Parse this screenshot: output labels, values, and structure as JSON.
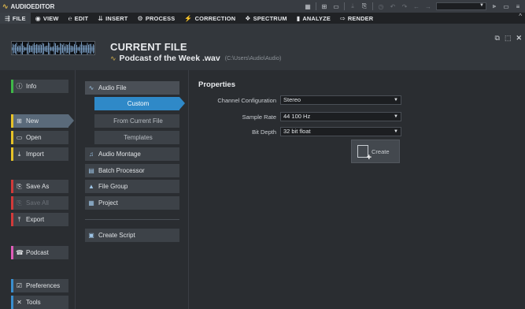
{
  "app": {
    "title": "AUDIOEDITOR"
  },
  "menu": {
    "items": [
      {
        "icon": "⇶",
        "label": "FILE"
      },
      {
        "icon": "◉",
        "label": "VIEW"
      },
      {
        "icon": "℮",
        "label": "EDIT"
      },
      {
        "icon": "⇊",
        "label": "INSERT"
      },
      {
        "icon": "⚙",
        "label": "PROCESS"
      },
      {
        "icon": "⚡",
        "label": "CORRECTION"
      },
      {
        "icon": "❖",
        "label": "SPECTRUM"
      },
      {
        "icon": "▮",
        "label": "ANALYZE"
      },
      {
        "icon": "⇨",
        "label": "RENDER"
      }
    ]
  },
  "header": {
    "title": "CURRENT FILE",
    "file_icon": "∿",
    "file_name": "Podcast of the Week .wav",
    "file_path": "(C:\\Users\\Audio\\Audio)"
  },
  "leftnav": {
    "items": [
      {
        "icon": "ⓘ",
        "label": "Info"
      },
      {
        "icon": "⊞",
        "label": "New"
      },
      {
        "icon": "▭",
        "label": "Open"
      },
      {
        "icon": "⤓",
        "label": "Import"
      },
      {
        "icon": "⎘",
        "label": "Save As"
      },
      {
        "icon": "⎘",
        "label": "Save All"
      },
      {
        "icon": "⤒",
        "label": "Export"
      },
      {
        "icon": "☎",
        "label": "Podcast"
      },
      {
        "icon": "☑",
        "label": "Preferences"
      },
      {
        "icon": "✕",
        "label": "Tools"
      }
    ]
  },
  "midnav": {
    "items": [
      {
        "icon": "∿",
        "label": "Audio File"
      },
      {
        "icon": "",
        "label": "Custom"
      },
      {
        "icon": "",
        "label": "From Current File"
      },
      {
        "icon": "",
        "label": "Templates"
      },
      {
        "icon": "♫",
        "label": "Audio Montage"
      },
      {
        "icon": "▤",
        "label": "Batch Processor"
      },
      {
        "icon": "▲",
        "label": "File Group"
      },
      {
        "icon": "▦",
        "label": "Project"
      },
      {
        "icon": "▣",
        "label": "Create Script"
      }
    ]
  },
  "properties": {
    "title": "Properties",
    "channel_label": "Channel Configuration",
    "channel_value": "Stereo",
    "rate_label": "Sample Rate",
    "rate_value": "44 100 Hz",
    "depth_label": "Bit Depth",
    "depth_value": "32 bit float",
    "create_label": "Create"
  },
  "colors": {
    "accent": "#2f89c8",
    "bg": "#2a2d31"
  }
}
